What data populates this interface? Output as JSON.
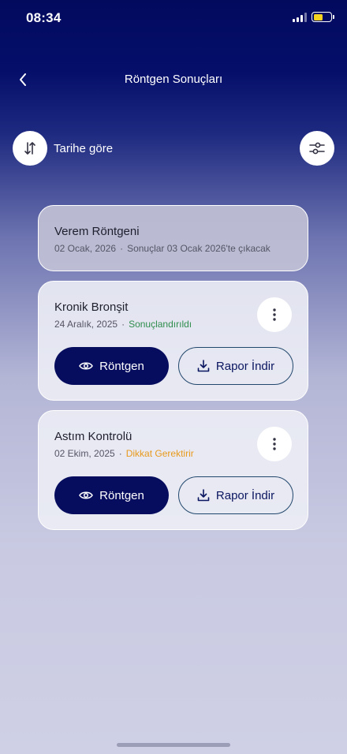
{
  "status_bar": {
    "time": "08:34",
    "battery_color": "#f4d21f"
  },
  "header": {
    "title": "Röntgen Sonuçları"
  },
  "toolbar": {
    "sort_label": "Tarihe göre"
  },
  "results": [
    {
      "title": "Verem Röntgeni",
      "date": "02 Ocak, 2026",
      "status": "Sonuçlar 03 Ocak 2026'te çıkacak",
      "state": "pending"
    },
    {
      "title": "Kronik Bronşit",
      "date": "24 Aralık, 2025",
      "status": "Sonuçlandırıldı",
      "state": "done",
      "status_color": "#2f8e4e",
      "view_label": "Röntgen",
      "download_label": "Rapor İndir"
    },
    {
      "title": "Astım Kontrolü",
      "date": "02 Ekim, 2025",
      "status": "Dikkat Gerektirir",
      "state": "attention",
      "status_color": "#e89a1c",
      "view_label": "Röntgen",
      "download_label": "Rapor İndir"
    }
  ],
  "colors": {
    "primary": "#060d5e",
    "accent_outline": "#22476c"
  }
}
